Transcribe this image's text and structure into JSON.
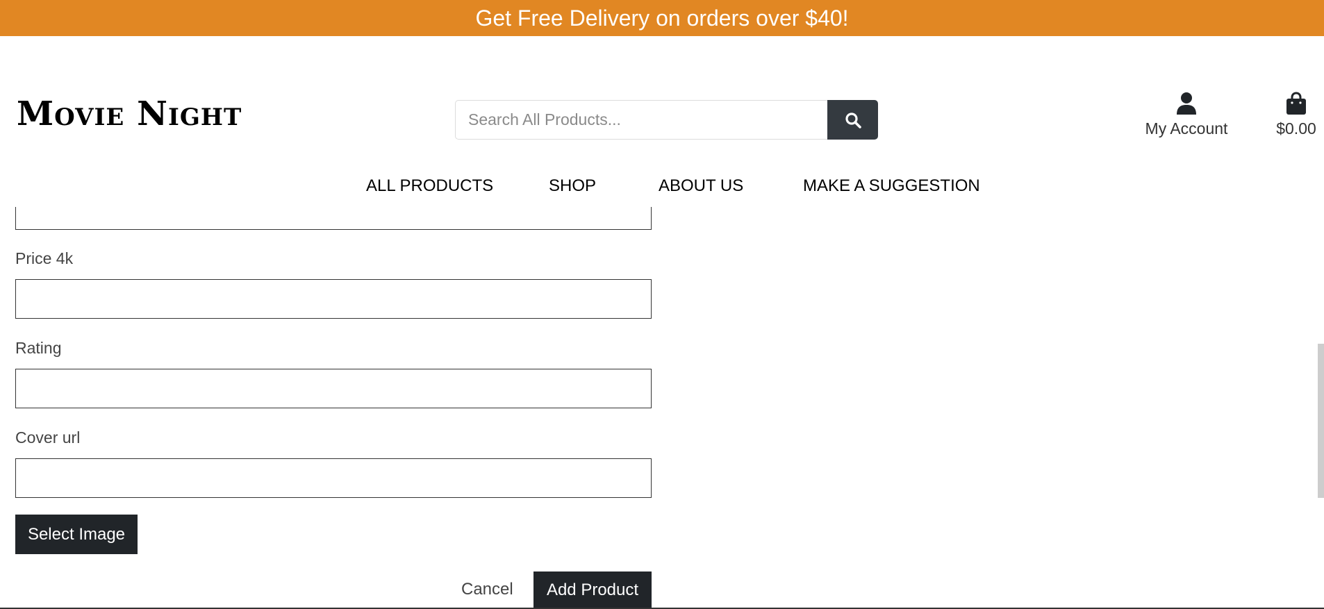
{
  "banner": {
    "text": "Get Free Delivery on orders over $40!"
  },
  "header": {
    "logo": "Movie Night",
    "search": {
      "placeholder": "Search All Products...",
      "value": ""
    },
    "account_label": "My Account",
    "cart_total": "$0.00"
  },
  "nav": {
    "items": [
      "ALL PRODUCTS",
      "SHOP",
      "ABOUT US",
      "MAKE A SUGGESTION"
    ]
  },
  "form": {
    "fields": [
      {
        "label": "Price 4k",
        "value": ""
      },
      {
        "label": "Rating",
        "value": ""
      },
      {
        "label": "Cover url",
        "value": ""
      }
    ],
    "select_image_label": "Select Image",
    "cancel_label": "Cancel",
    "submit_label": "Add Product"
  },
  "colors": {
    "banner": "#e18723",
    "dark_button": "#212529",
    "search_button": "#343a40"
  },
  "icons": {
    "search": "search-icon",
    "account": "user-icon",
    "cart": "shopping-bag-icon"
  }
}
